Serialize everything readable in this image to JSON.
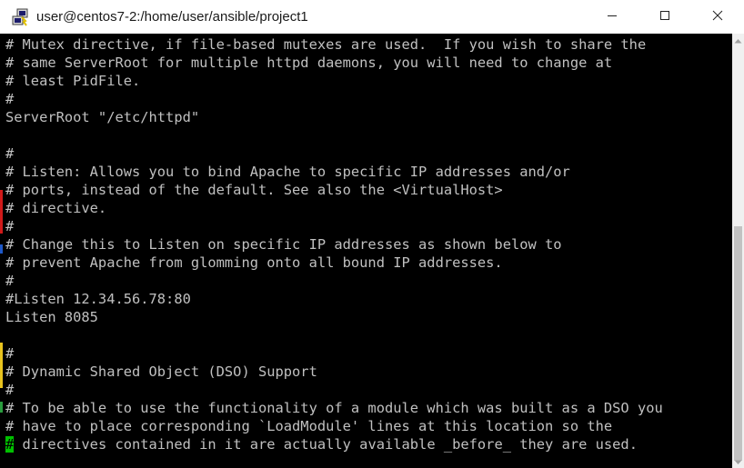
{
  "window": {
    "title": "user@centos7-2:/home/user/ansible/project1",
    "app_icon": "putty-icon",
    "controls": {
      "minimize": "minimize-icon",
      "maximize": "maximize-icon",
      "close": "close-icon"
    }
  },
  "terminal": {
    "lines": [
      "# Mutex directive, if file-based mutexes are used.  If you wish to share the",
      "# same ServerRoot for multiple httpd daemons, you will need to change at",
      "# least PidFile.",
      "#",
      "ServerRoot \"/etc/httpd\"",
      "",
      "#",
      "# Listen: Allows you to bind Apache to specific IP addresses and/or",
      "# ports, instead of the default. See also the <VirtualHost>",
      "# directive.",
      "#",
      "# Change this to Listen on specific IP addresses as shown below to",
      "# prevent Apache from glomming onto all bound IP addresses.",
      "#",
      "#Listen 12.34.56.78:80",
      "Listen 8085",
      "",
      "#",
      "# Dynamic Shared Object (DSO) Support",
      "#",
      "# To be able to use the functionality of a module which was built as a DSO you",
      "# have to place corresponding `LoadModule' lines at this location so the"
    ],
    "last_line": {
      "cursor_char": "#",
      "rest": " directives contained in it are actually available _before_ they are used."
    },
    "colors": {
      "background": "#000000",
      "foreground": "#c0c0c0",
      "cursor": "#00c000"
    }
  },
  "scrollbar": {
    "up_arrow": "scroll-up-icon",
    "down_arrow": "scroll-down-icon"
  }
}
